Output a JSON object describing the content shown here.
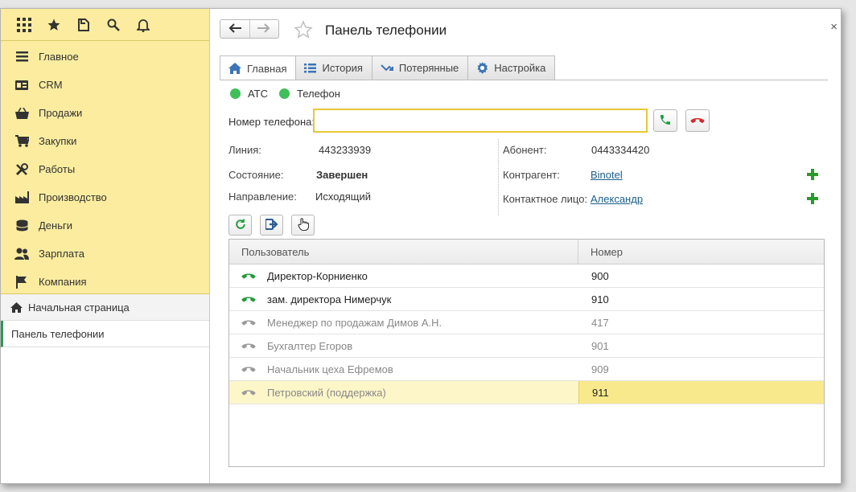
{
  "sidebar": {
    "menu": [
      {
        "label": "Главное",
        "icon": "list-icon"
      },
      {
        "label": "CRM",
        "icon": "crm-icon"
      },
      {
        "label": "Продажи",
        "icon": "basket-icon"
      },
      {
        "label": "Закупки",
        "icon": "cart-icon"
      },
      {
        "label": "Работы",
        "icon": "tools-icon"
      },
      {
        "label": "Производство",
        "icon": "factory-icon"
      },
      {
        "label": "Деньги",
        "icon": "money-icon"
      },
      {
        "label": "Зарплата",
        "icon": "people-icon"
      },
      {
        "label": "Компания",
        "icon": "flag-icon"
      }
    ],
    "open_windows": [
      {
        "label": "Начальная страница"
      },
      {
        "label": "Панель телефонии"
      }
    ]
  },
  "header": {
    "title": "Панель телефонии",
    "close": "×"
  },
  "tabs": [
    {
      "label": "Главная",
      "icon": "home-icon"
    },
    {
      "label": "История",
      "icon": "list-icon"
    },
    {
      "label": "Потерянные",
      "icon": "missed-call-icon"
    },
    {
      "label": "Настройка",
      "icon": "gear-icon"
    }
  ],
  "status": {
    "pbx": "АТС",
    "phone": "Телефон",
    "color": "#3fbf5a"
  },
  "phone_field": {
    "label": "Номер телефона:",
    "value": ""
  },
  "details": {
    "line_label": "Линия:",
    "line_value": "443233939",
    "state_label": "Состояние:",
    "state_value": "Завершен",
    "direction_label": "Направление:",
    "direction_value": "Исходящий",
    "subscriber_label": "Абонент:",
    "subscriber_value": "0443334420",
    "counterparty_label": "Контрагент:",
    "counterparty_value": "Binotel",
    "contact_label": "Контактное лицо:",
    "contact_value": "Александр"
  },
  "table": {
    "headers": [
      "Пользователь",
      "Номер"
    ],
    "rows": [
      {
        "user": "Директор-Корниенко",
        "number": "900",
        "state": "active"
      },
      {
        "user": "зам. директора Нимерчук",
        "number": "910",
        "state": "active"
      },
      {
        "user": "Менеджер по продажам Димов А.Н.",
        "number": "417",
        "state": "inactive"
      },
      {
        "user": "Бухгалтер Егоров",
        "number": "901",
        "state": "inactive"
      },
      {
        "user": "Начальник цеха Ефремов",
        "number": "909",
        "state": "inactive"
      },
      {
        "user": "Петровский (поддержка)",
        "number": "911",
        "state": "inactive-selected"
      }
    ]
  },
  "colors": {
    "sidebar_bg": "#fbec9f",
    "active_handset": "#1f9b3c",
    "inactive_handset": "#9a9a9a",
    "hangup": "#d42a2a",
    "link": "#1a5e8a",
    "selection": "#f8e98c"
  }
}
